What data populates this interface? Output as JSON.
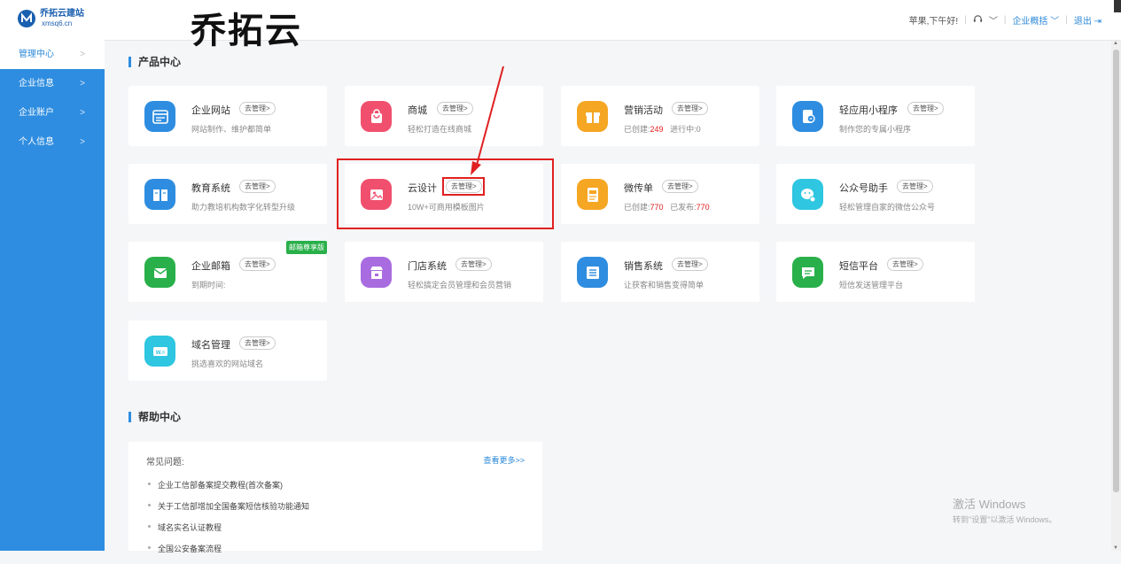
{
  "header": {
    "logo_cn": "乔拓云建站",
    "logo_en": "xmsq6.cn",
    "big_title": "乔拓云",
    "greeting": "苹果,下午好!",
    "service_icon": "headset-icon",
    "overview_link": "企业概括",
    "logout": "退出"
  },
  "sidebar": {
    "items": [
      {
        "label": "管理中心"
      },
      {
        "label": "企业信息"
      },
      {
        "label": "企业账户"
      },
      {
        "label": "个人信息"
      }
    ]
  },
  "products": {
    "section_title": "产品中心",
    "manage_label": "去管理>",
    "cards": [
      {
        "name": "企业网站",
        "desc": "网站制作、维护都简单",
        "icon": "browser-icon",
        "color": "#2e8de0"
      },
      {
        "name": "商城",
        "desc": "轻松打造在线商城",
        "icon": "shopping-bag-icon",
        "color": "#f0506e"
      },
      {
        "name": "营销活动",
        "desc_a": "已创建:",
        "num_a": "249",
        "desc_b": "进行中:",
        "num_b": "0",
        "icon": "gift-icon",
        "color": "#f5a623"
      },
      {
        "name": "轻应用小程序",
        "desc": "制作您的专属小程序",
        "icon": "miniprogram-icon",
        "color": "#2e8de0"
      },
      {
        "name": "教育系统",
        "desc": "助力教培机构数字化转型升级",
        "icon": "book-icon",
        "color": "#2e8de0"
      },
      {
        "name": "云设计",
        "desc": "10W+可商用模板图片",
        "icon": "image-icon",
        "color": "#f0506e"
      },
      {
        "name": "微传单",
        "desc_a": "已创建:",
        "num_a": "770",
        "desc_b": "已发布:",
        "num_b": "770",
        "icon": "flyer-icon",
        "color": "#f5a623"
      },
      {
        "name": "公众号助手",
        "desc": "轻松管理自家的微信公众号",
        "icon": "wechat-icon",
        "color": "#2ec6e0"
      },
      {
        "name": "企业邮箱",
        "desc": "到期时间:",
        "badge": "邮箱尊享版",
        "icon": "mail-icon",
        "color": "#29b04a"
      },
      {
        "name": "门店系统",
        "desc": "轻松搞定会员管理和会员营销",
        "icon": "store-icon",
        "color": "#a86ce0"
      },
      {
        "name": "销售系统",
        "desc": "让获客和销售变得简单",
        "icon": "list-icon",
        "color": "#2e8de0"
      },
      {
        "name": "短信平台",
        "desc": "短信发送管理平台",
        "icon": "message-icon",
        "color": "#29b04a"
      },
      {
        "name": "域名管理",
        "desc": "挑选喜欢的网站域名",
        "icon": "domain-icon",
        "color": "#2ec6e0"
      }
    ]
  },
  "help": {
    "section_title": "帮助中心",
    "faq_title": "常见问题:",
    "more": "查看更多>>",
    "items": [
      "企业工信部备案提交教程(首次备案)",
      "关于工信部增加全国备案短信核验功能通知",
      "域名实名认证教程",
      "全国公安备案流程"
    ]
  },
  "watermark": {
    "line1": "激活 Windows",
    "line2": "转到\"设置\"以激活 Windows。"
  }
}
